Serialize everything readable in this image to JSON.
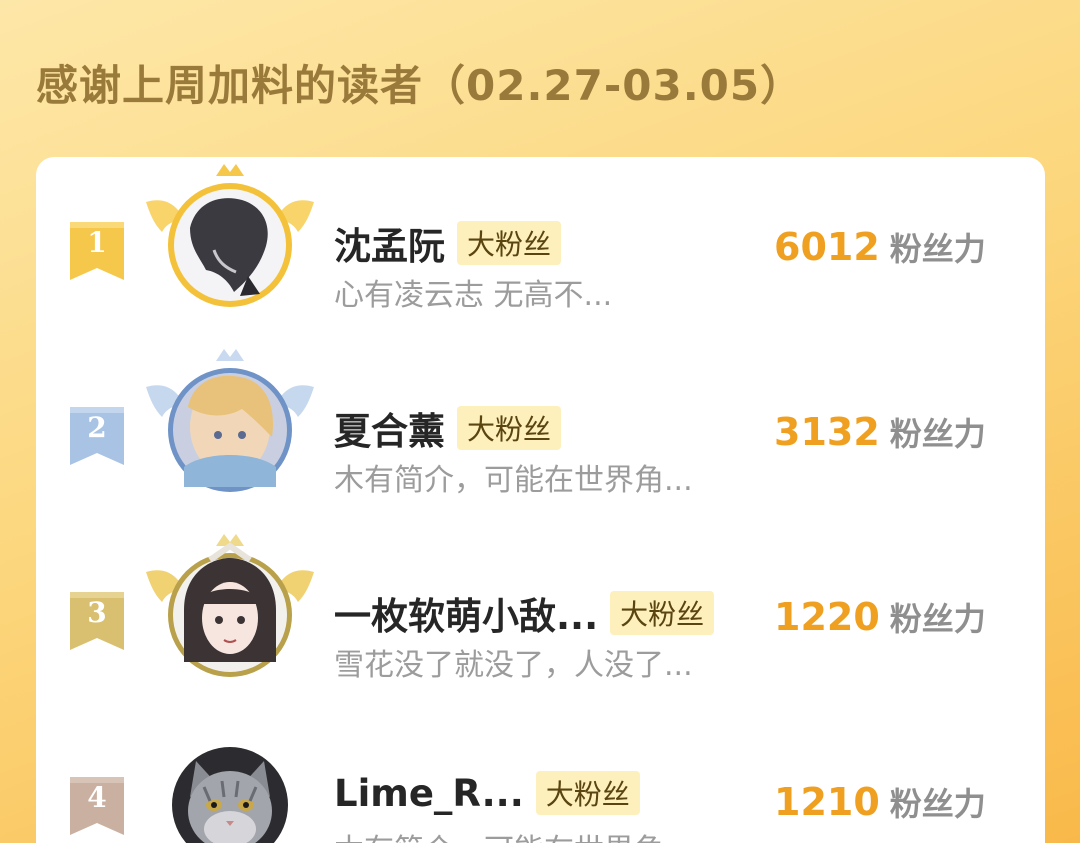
{
  "header": {
    "title": "感谢上周加料的读者（02.27-03.05）"
  },
  "colors": {
    "gold": "#f5c84c",
    "silver": "#a9c3e4",
    "bronze": "#d9c070",
    "fourth": "#c9b0a0",
    "score": "#f0a020"
  },
  "readers": [
    {
      "rank": "1",
      "name": "沈孟阮",
      "badge": "大粉丝",
      "bio": "心有凌云志 无高不...",
      "score": "6012",
      "unit": "粉丝力"
    },
    {
      "rank": "2",
      "name": "夏合薰",
      "badge": "大粉丝",
      "bio": "木有简介，可能在世界角...",
      "score": "3132",
      "unit": "粉丝力"
    },
    {
      "rank": "3",
      "name": "一枚软萌小敌...",
      "badge": "大粉丝",
      "bio": "雪花没了就没了，人没了...",
      "score": "1220",
      "unit": "粉丝力"
    },
    {
      "rank": "4",
      "name": "Lime_R...",
      "badge": "大粉丝",
      "bio": "木有简介，可能在世界角...",
      "score": "1210",
      "unit": "粉丝力"
    }
  ]
}
